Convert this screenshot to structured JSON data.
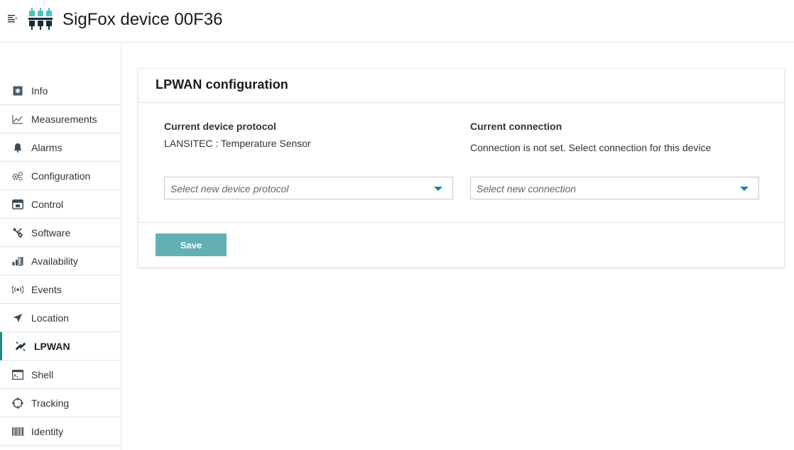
{
  "header": {
    "title": "SigFox device 00F36",
    "menu_icon": "menu-toggle-icon",
    "logo_icon": "device-logo-icon"
  },
  "sidebar": {
    "items": [
      {
        "label": "Info",
        "icon": "info-icon"
      },
      {
        "label": "Measurements",
        "icon": "line-chart-icon"
      },
      {
        "label": "Alarms",
        "icon": "bell-icon"
      },
      {
        "label": "Configuration",
        "icon": "gears-icon"
      },
      {
        "label": "Control",
        "icon": "control-panel-icon"
      },
      {
        "label": "Software",
        "icon": "wrench-icon"
      },
      {
        "label": "Availability",
        "icon": "bar-chart-icon"
      },
      {
        "label": "Events",
        "icon": "broadcast-icon"
      },
      {
        "label": "Location",
        "icon": "location-arrow-icon"
      },
      {
        "label": "LPWAN",
        "icon": "lpwan-satellite-icon",
        "active": true
      },
      {
        "label": "Shell",
        "icon": "terminal-icon"
      },
      {
        "label": "Tracking",
        "icon": "crosshair-icon"
      },
      {
        "label": "Identity",
        "icon": "barcode-icon"
      }
    ]
  },
  "card": {
    "title": "LPWAN configuration",
    "protocol": {
      "label": "Current device protocol",
      "value": "LANSITEC : Temperature Sensor",
      "placeholder": "Select new device protocol"
    },
    "connection": {
      "label": "Current connection",
      "value": "Connection is not set. Select connection for this device",
      "placeholder": "Select new connection"
    },
    "save_label": "Save"
  },
  "colors": {
    "accent": "#1b8a8e",
    "button": "#62b0b4",
    "caret": "#1b7f9a"
  }
}
